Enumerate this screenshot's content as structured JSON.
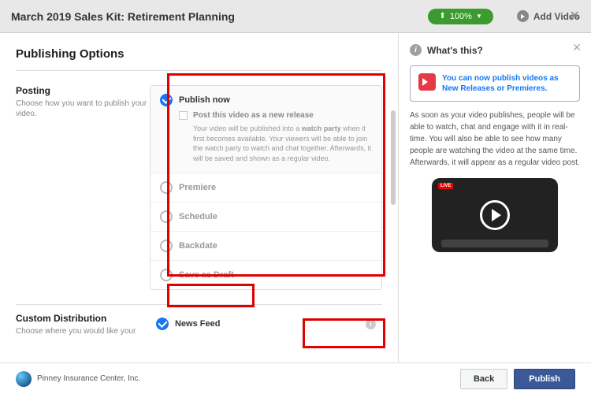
{
  "header": {
    "title": "March 2019 Sales Kit: Retirement Planning",
    "progress": "100%",
    "add_video": "Add Video"
  },
  "panel": {
    "title": "Publishing Options",
    "posting": {
      "title": "Posting",
      "subtitle": "Choose how you want to publish your video."
    },
    "options": {
      "publish_now": "Publish now",
      "new_release_label": "Post this video as a new release",
      "new_release_desc_pre": "Your video will be published into a ",
      "new_release_desc_bold": "watch party",
      "new_release_desc_post": " when it first becomes available. Your viewers will be able to join the watch party to watch and chat together. Afterwards, it will be saved and shown as a regular video.",
      "premiere": "Premiere",
      "schedule": "Schedule",
      "backdate": "Backdate",
      "save_draft": "Save as Draft"
    },
    "custom": {
      "title": "Custom Distribution",
      "subtitle": "Choose where you would like your",
      "news_feed": "News Feed"
    },
    "footer": {
      "company": "Pinney Insurance Center, Inc.",
      "back": "Back",
      "publish": "Publish"
    }
  },
  "side": {
    "whats_this": "What's this?",
    "info_card": "You can now publish videos as New Releases or Premieres.",
    "desc": "As soon as your video publishes, people will be able to watch, chat and engage with it in real-time. You will also be able to see how many people are watching the video at the same time. Afterwards, it will appear as a regular video post.",
    "live": "LIVE"
  }
}
